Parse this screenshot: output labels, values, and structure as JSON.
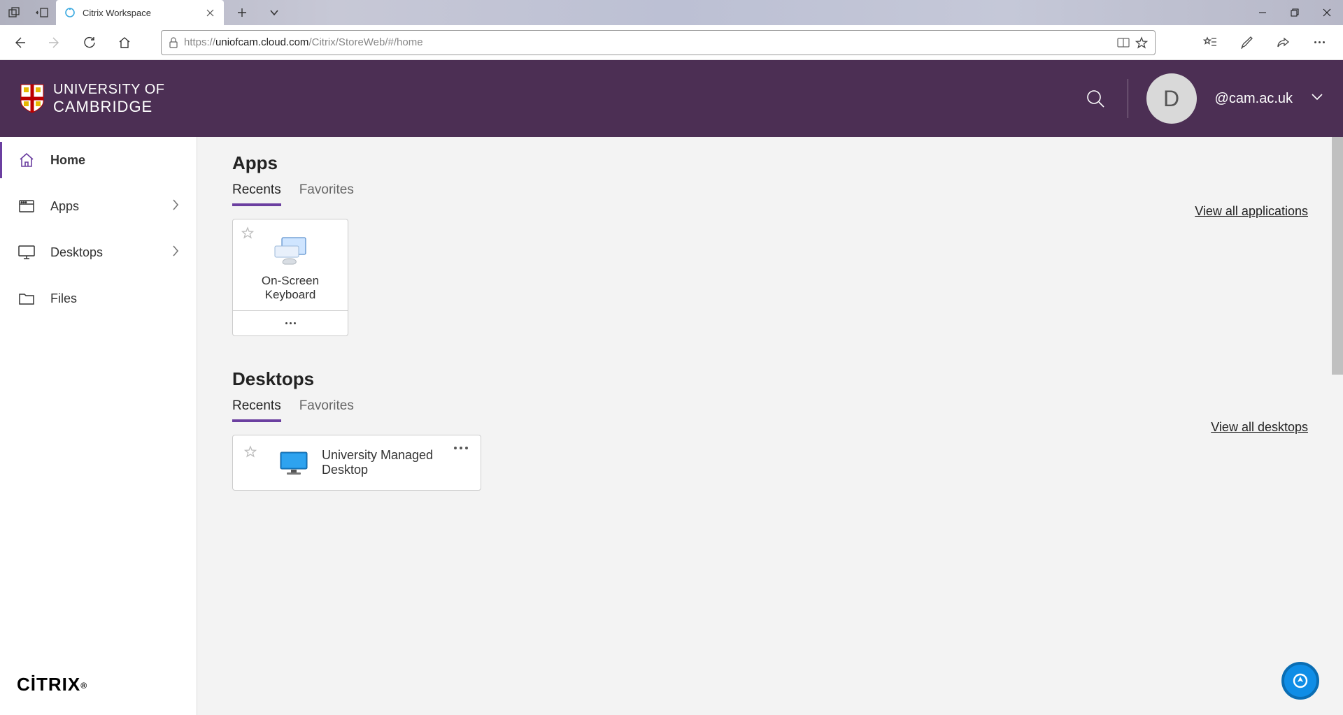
{
  "browser": {
    "tab_title": "Citrix Workspace",
    "url_prefix": "https://",
    "url_host": "uniofcam.cloud.com",
    "url_path": "/Citrix/StoreWeb/#/home"
  },
  "header": {
    "logo_line1": "UNIVERSITY OF",
    "logo_line2": "CAMBRIDGE",
    "avatar_letter": "D",
    "user_email": "@cam.ac.uk"
  },
  "sidebar": {
    "items": [
      {
        "label": "Home"
      },
      {
        "label": "Apps"
      },
      {
        "label": "Desktops"
      },
      {
        "label": "Files"
      }
    ],
    "citrix_label": "CİTRIX"
  },
  "apps_section": {
    "title": "Apps",
    "tab_recents": "Recents",
    "tab_favorites": "Favorites",
    "view_all": "View all applications",
    "app0_name": "On-Screen Keyboard"
  },
  "desktops_section": {
    "title": "Desktops",
    "tab_recents": "Recents",
    "tab_favorites": "Favorites",
    "view_all": "View all desktops",
    "desk0_name": "University Managed Desktop"
  }
}
